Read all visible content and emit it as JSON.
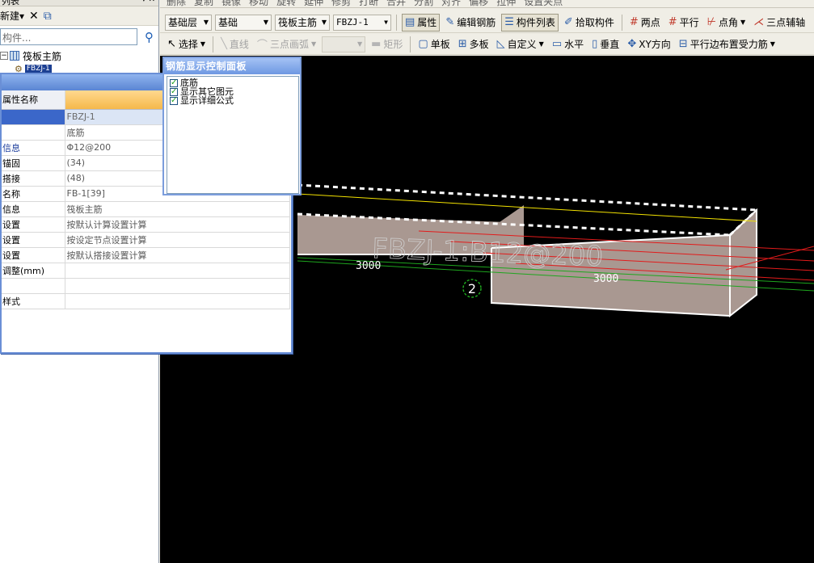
{
  "left_panel": {
    "top_title": "列表",
    "new_label": "新建",
    "new_arrow": "▾",
    "delete_icon": "✕",
    "copy_icon": "⧉",
    "search_placeholder": "构件...",
    "search_icon": "⚲",
    "tree": {
      "root_label": "筏板主筋",
      "child_label": "FBZJ-1"
    }
  },
  "toolbar_row0": [
    "删除",
    "复制",
    "镜像",
    "移动",
    "旋转",
    "延伸",
    "修剪",
    "打断",
    "合并",
    "分割",
    "对齐",
    "偏移",
    "拉伸",
    "设置夹点"
  ],
  "toolbar_row1": {
    "floor_combo": "基础层",
    "category_combo": "基础",
    "type_combo": "筏板主筋",
    "component_combo": "FBZJ-1",
    "properties_button": "属性",
    "edit_rebar_button": "编辑钢筋",
    "component_list_button": "构件列表",
    "pick_component_button": "拾取构件",
    "two_point_button": "两点",
    "parallel_button": "平行",
    "point_angle_button": "点角",
    "three_point_axis_button": "三点辅轴"
  },
  "toolbar_row2": {
    "select_button": "选择",
    "line_button": "直线",
    "arc_button": "三点画弧",
    "rect_button": "矩形",
    "single_slab_button": "单板",
    "multi_slab_button": "多板",
    "custom_button": "自定义",
    "horizontal_button": "水平",
    "vertical_button": "垂直",
    "xy_button": "XY方向",
    "parallel_edge_button": "平行边布置受力筋"
  },
  "properties": {
    "header_name": "属性名称",
    "rows": [
      {
        "name": "",
        "value": "FBZJ-1"
      },
      {
        "name": "",
        "value": "底筋"
      },
      {
        "name": "信息",
        "value": "Φ12@200"
      },
      {
        "name": "锚固",
        "value": "(34)"
      },
      {
        "name": "搭接",
        "value": "(48)"
      },
      {
        "name": "名称",
        "value": "FB-1[39]"
      },
      {
        "name": "信息",
        "value": "筏板主筋"
      },
      {
        "name": "设置",
        "value": "按默认计算设置计算"
      },
      {
        "name": "设置",
        "value": "按设定节点设置计算"
      },
      {
        "name": "设置",
        "value": "按默认搭接设置计算"
      },
      {
        "name": "调整(mm)",
        "value": ""
      },
      {
        "name": "",
        "value": ""
      },
      {
        "name": "样式",
        "value": ""
      }
    ]
  },
  "rebar_panel": {
    "title": "钢筋显示控制面板",
    "options": [
      "底筋",
      "显示其它图元",
      "显示详细公式"
    ]
  },
  "viewport": {
    "label_rebar": "FBZJ-1:B12@200",
    "dim_left": "3000",
    "dim_right": "3000",
    "axis_label": "2",
    "colors": {
      "background": "#000000",
      "slab": "#a99891",
      "red_rebar": "#e21b1b",
      "yellow_rebar": "#f3e200",
      "green_axis": "#1ea61e"
    }
  }
}
